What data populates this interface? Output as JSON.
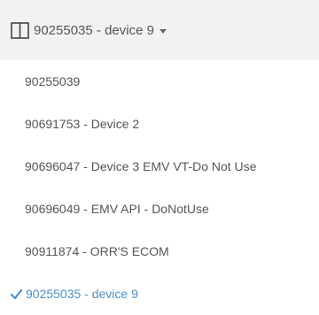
{
  "selector": {
    "icon": "columns-icon",
    "current_label": "90255035 - device 9",
    "caret_icon": "caret-down-icon"
  },
  "menu": {
    "items": [
      {
        "label": "90255039",
        "selected": false
      },
      {
        "label": "90691753 - Device 2",
        "selected": false
      },
      {
        "label": "90696047 - Device 3 EMV VT-Do Not Use",
        "selected": false
      },
      {
        "label": "90696049 - EMV API - DoNotUse",
        "selected": false
      },
      {
        "label": "90911874 - ORR'S ECOM",
        "selected": false
      },
      {
        "label": "90255035 - device 9",
        "selected": true
      }
    ],
    "check_icon": "checkmark-icon"
  },
  "colors": {
    "header_bg": "#f2f2f2",
    "text": "#555555",
    "selected_accent": "#4a90c8"
  }
}
